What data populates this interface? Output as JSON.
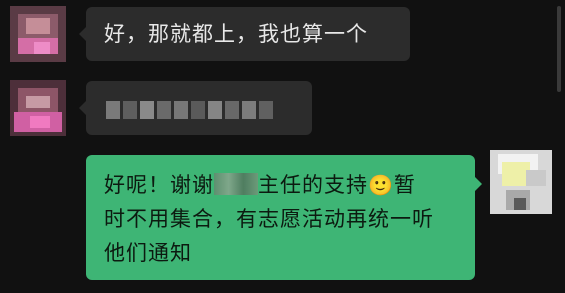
{
  "messages": [
    {
      "sender": "other",
      "text": "好，那就都上，我也算一个",
      "avatar": "pixelated-avatar"
    },
    {
      "sender": "other",
      "text": "",
      "redacted": true,
      "avatar": "pixelated-avatar"
    },
    {
      "sender": "self",
      "line1_a": "好呢！谢谢",
      "line1_b": "主任的支持",
      "emoji": "🙂",
      "line1_c": "暂",
      "line2": "时不用集合，有志愿活动再统一听",
      "line3": "他们通知",
      "avatar": "pixelated-avatar"
    }
  ],
  "colors": {
    "background": "#111111",
    "incoming_bubble": "#2c2c2c",
    "outgoing_bubble": "#3eb575"
  }
}
